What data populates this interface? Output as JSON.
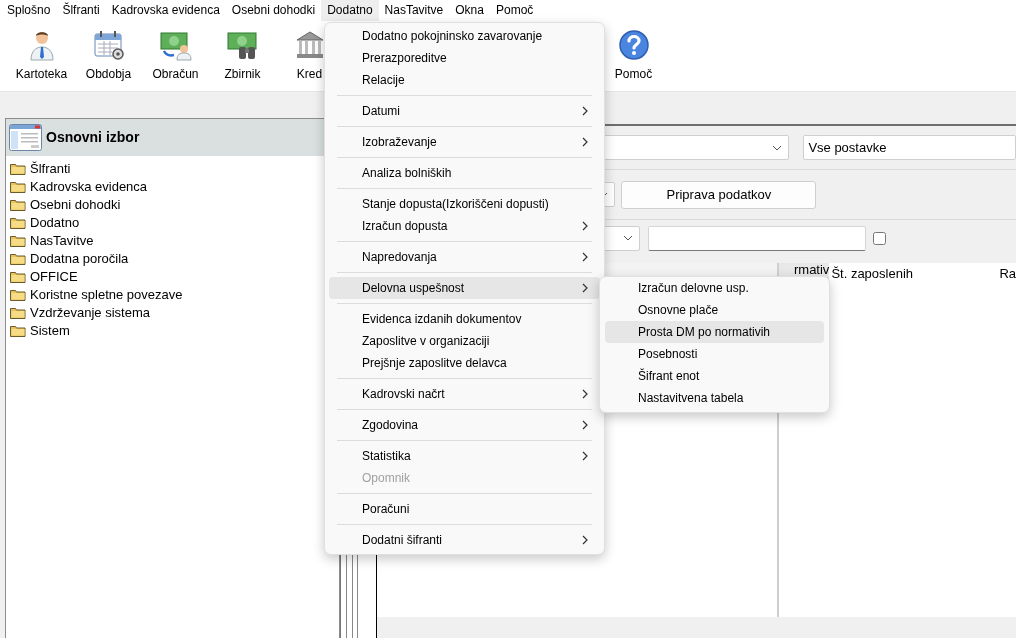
{
  "menu_bar": [
    {
      "label": "Splošno",
      "selected": false
    },
    {
      "label": "Šlfranti",
      "selected": false
    },
    {
      "label": "Kadrovska evidenca",
      "selected": false
    },
    {
      "label": "Osebni dohodki",
      "selected": false
    },
    {
      "label": "Dodatno",
      "selected": true
    },
    {
      "label": "NasTavitve",
      "selected": false
    },
    {
      "label": "Okna",
      "selected": false
    },
    {
      "label": "Pomoč",
      "selected": false
    }
  ],
  "toolbar": [
    {
      "label": "Kartoteka",
      "kind": "person"
    },
    {
      "label": "Obdobja",
      "kind": "calendar"
    },
    {
      "label": "Obračun",
      "kind": "payment"
    },
    {
      "label": "Zbirnik",
      "kind": "summary"
    },
    {
      "label": "Kred",
      "kind": "bank"
    },
    {
      "label": "Pomoč",
      "kind": "help"
    }
  ],
  "tree": {
    "title": "Osnovni izbor",
    "items": [
      {
        "label": "Šlfranti"
      },
      {
        "label": "Kadrovska evidenca"
      },
      {
        "label": "Osebni dohodki"
      },
      {
        "label": "Dodatno"
      },
      {
        "label": "NasTavitve"
      },
      {
        "label": "Dodatna poročila"
      },
      {
        "label": "OFFICE"
      },
      {
        "label": "Koristne spletne povezave"
      },
      {
        "label": "Vzdrževanje sistema"
      },
      {
        "label": "Sistem"
      }
    ]
  },
  "form": {
    "filter_field": {
      "value": "Vse postavke"
    },
    "prepare_button": {
      "label": "Priprava podatkov"
    },
    "checkbox": {
      "checked": false
    }
  },
  "table": {
    "columns": [
      "rmativ",
      "Št. zaposlenih",
      "Ra"
    ]
  },
  "menu": {
    "groups": [
      {
        "items": [
          {
            "label": "Dodatno pokojninsko zavarovanje",
            "submenu": false,
            "disabled": false,
            "selected": false
          },
          {
            "label": "Prerazporeditve",
            "submenu": false,
            "disabled": false,
            "selected": false
          },
          {
            "label": "Relacije",
            "submenu": false,
            "disabled": false,
            "selected": false
          }
        ]
      },
      {
        "items": [
          {
            "label": "Datumi",
            "submenu": true,
            "disabled": false,
            "selected": false
          }
        ]
      },
      {
        "items": [
          {
            "label": "Izobraževanje",
            "submenu": true,
            "disabled": false,
            "selected": false
          }
        ]
      },
      {
        "items": [
          {
            "label": "Analiza bolniških",
            "submenu": false,
            "disabled": false,
            "selected": false
          }
        ]
      },
      {
        "items": [
          {
            "label": "Stanje dopusta(Izkoriščeni dopusti)",
            "submenu": false,
            "disabled": false,
            "selected": false
          },
          {
            "label": "Izračun dopusta",
            "submenu": true,
            "disabled": false,
            "selected": false
          }
        ]
      },
      {
        "items": [
          {
            "label": "Napredovanja",
            "submenu": true,
            "disabled": false,
            "selected": false
          }
        ]
      },
      {
        "items": [
          {
            "label": "Delovna uspešnost",
            "submenu": true,
            "disabled": false,
            "selected": true
          }
        ]
      },
      {
        "items": [
          {
            "label": "Evidenca izdanih dokumentov",
            "submenu": false,
            "disabled": false,
            "selected": false
          },
          {
            "label": "Zaposlitve v organizaciji",
            "submenu": false,
            "disabled": false,
            "selected": false
          },
          {
            "label": "Prejšnje zaposlitve delavca",
            "submenu": false,
            "disabled": false,
            "selected": false
          }
        ]
      },
      {
        "items": [
          {
            "label": "Kadrovski načrt",
            "submenu": true,
            "disabled": false,
            "selected": false
          }
        ]
      },
      {
        "items": [
          {
            "label": "Zgodovina",
            "submenu": true,
            "disabled": false,
            "selected": false
          }
        ]
      },
      {
        "items": [
          {
            "label": "Statistika",
            "submenu": true,
            "disabled": false,
            "selected": false
          },
          {
            "label": "Opomnik",
            "submenu": false,
            "disabled": true,
            "selected": false
          }
        ]
      },
      {
        "items": [
          {
            "label": "Poračuni",
            "submenu": false,
            "disabled": false,
            "selected": false
          }
        ]
      },
      {
        "items": [
          {
            "label": "Dodatni šifranti",
            "submenu": true,
            "disabled": false,
            "selected": false
          }
        ]
      }
    ]
  },
  "submenu": {
    "items": [
      {
        "label": "Izračun delovne usp.",
        "selected": false
      },
      {
        "label": "Osnovne plače",
        "selected": false
      },
      {
        "label": "Prosta DM po normativih",
        "selected": true
      },
      {
        "label": "Posebnosti",
        "selected": false
      },
      {
        "label": "Šifrant enot",
        "selected": false
      },
      {
        "label": "Nastavitvena tabela",
        "selected": false
      }
    ]
  }
}
